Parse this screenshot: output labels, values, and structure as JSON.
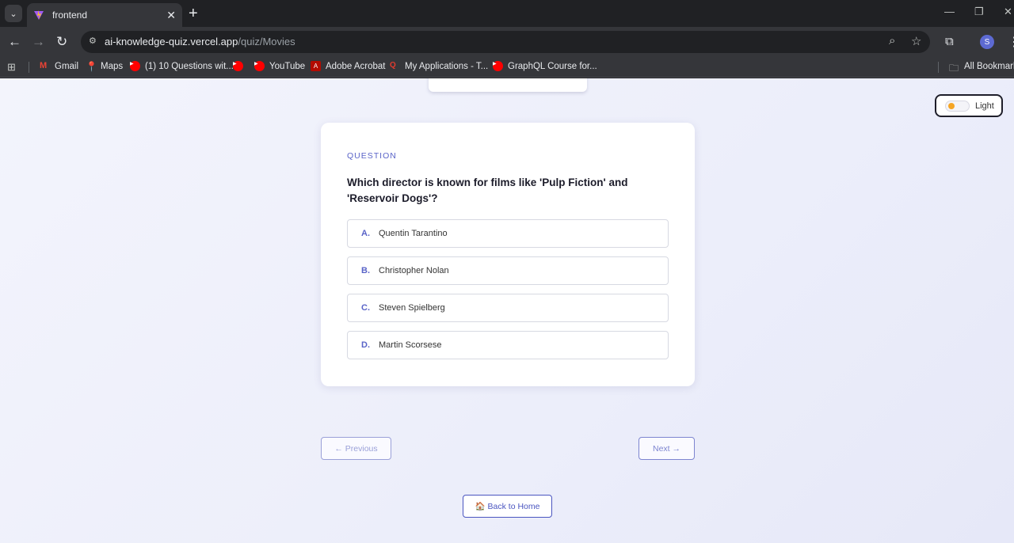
{
  "browser": {
    "tab_title": "frontend",
    "url_domain": "ai-knowledge-quiz.vercel.app",
    "url_path": "/quiz/Movies",
    "profile_initial": "S",
    "bookmarks": [
      {
        "label": "Gmail",
        "icon": "gmail-icon"
      },
      {
        "label": "Maps",
        "icon": "maps-icon"
      },
      {
        "label": "(1) 10 Questions wit...",
        "icon": "youtube-icon"
      },
      {
        "label": "",
        "icon": "youtube-icon"
      },
      {
        "label": "YouTube",
        "icon": "youtube-icon"
      },
      {
        "label": "Adobe Acrobat",
        "icon": "acrobat-icon"
      },
      {
        "label": "My Applications - T...",
        "icon": "app-icon"
      },
      {
        "label": "GraphQL Course for...",
        "icon": "youtube-icon"
      }
    ],
    "all_bookmarks_label": "All Bookmarks"
  },
  "theme_toggle": {
    "label": "Light"
  },
  "quiz": {
    "eyebrow": "QUESTION",
    "question": "Which director is known for films like 'Pulp Fiction' and 'Reservoir Dogs'?",
    "options": [
      {
        "letter": "A.",
        "text": "Quentin Tarantino"
      },
      {
        "letter": "B.",
        "text": "Christopher Nolan"
      },
      {
        "letter": "C.",
        "text": "Steven Spielberg"
      },
      {
        "letter": "D.",
        "text": "Martin Scorsese"
      }
    ]
  },
  "nav": {
    "previous_label": "← Previous",
    "next_label": "Next →",
    "home_label": "🏠 Back to Home"
  },
  "colors": {
    "accent": "#5a64c8",
    "toggle_knob": "#f5a524"
  }
}
